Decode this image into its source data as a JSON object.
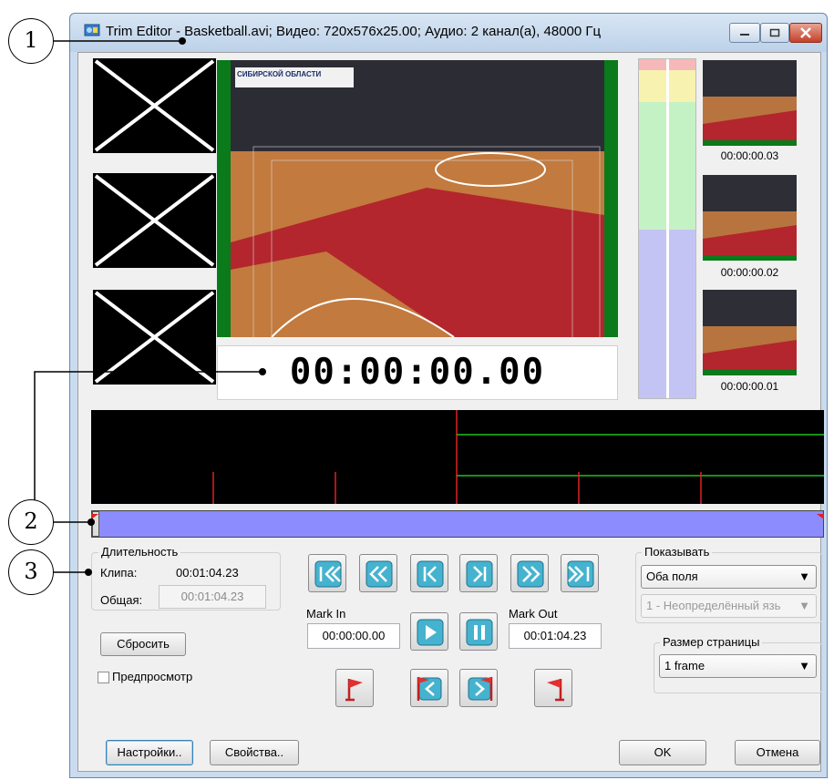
{
  "window": {
    "title": "Trim Editor - Basketball.avi; Видео: 720x576x25.00; Аудио: 2 канал(а), 48000 Гц",
    "icon": "app-icon",
    "controls": {
      "minimize": "minimize-icon",
      "maximize": "maximize-icon",
      "close": "close-icon"
    }
  },
  "viewer": {
    "timecode": "00:00:00.00",
    "banner_text": "СИБИРСКОЙ ОБЛАСТИ"
  },
  "previews": [
    {
      "time": "00:00:00.03"
    },
    {
      "time": "00:00:00.02"
    },
    {
      "time": "00:00:00.01"
    }
  ],
  "duration": {
    "group_label": "Длительность",
    "clip_label": "Клипа:",
    "clip_value": "00:01:04.23",
    "total_label": "Общая:",
    "total_value": "00:01:04.23"
  },
  "left_controls": {
    "reset_label": "Сбросить",
    "preview_label": "Предпросмотр",
    "preview_checked": false
  },
  "transport": {
    "buttons": [
      "go-start-icon",
      "rewind-icon",
      "prev-frame-icon",
      "next-frame-icon",
      "fast-forward-icon",
      "go-end-icon"
    ],
    "play": "play-icon",
    "pause": "pause-icon",
    "mark_in_label": "Mark In",
    "mark_in_value": "00:00:00.00",
    "mark_out_label": "Mark Out",
    "mark_out_value": "00:01:04.23",
    "marker_buttons": [
      "set-in-flag-icon",
      "go-to-in-flag-icon",
      "go-to-out-flag-icon",
      "set-out-flag-icon"
    ]
  },
  "show": {
    "group_label": "Показывать",
    "fields_value": "Оба поля",
    "language_value": "1 - Неопределённый язь"
  },
  "page_size": {
    "group_label": "Размер страницы",
    "value": "1 frame"
  },
  "footer": {
    "settings_label": "Настройки..",
    "properties_label": "Свойства..",
    "ok_label": "OK",
    "cancel_label": "Отмена"
  },
  "callouts": [
    "1",
    "2",
    "3"
  ],
  "colors": {
    "scrub_bar": "#8c8cff",
    "timeline_bg": "#000000",
    "timeline_red": "#e02020",
    "timeline_green": "#20c020",
    "court_red": "#b3262d",
    "level_red": "#f6b8b8",
    "level_yellow": "#f8f2b0",
    "level_green": "#c4f2c4",
    "level_blue": "#c4c4f4"
  }
}
